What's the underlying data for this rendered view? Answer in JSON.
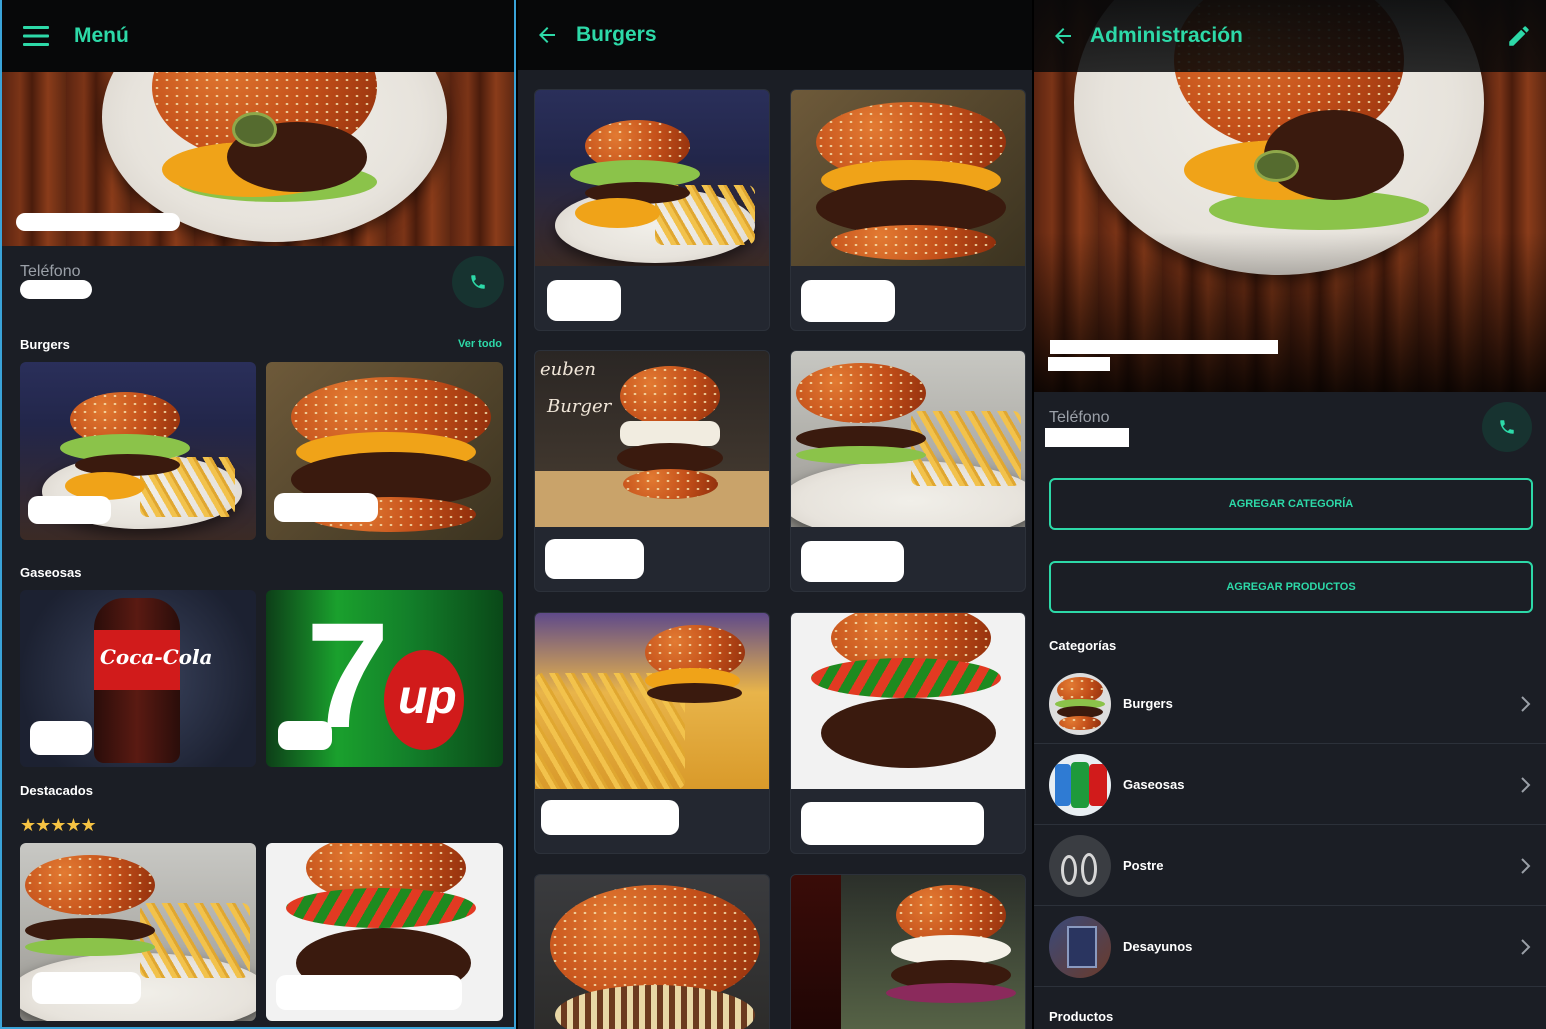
{
  "menu_screen": {
    "title": "Menú",
    "phone_label": "Teléfono",
    "sections": [
      {
        "title": "Burgers",
        "see_all": "Ver todo"
      },
      {
        "title": "Gaseosas"
      },
      {
        "title": "Destacados",
        "rating": "★★★★★"
      }
    ]
  },
  "burgers_screen": {
    "title": "Burgers"
  },
  "admin_screen": {
    "title": "Administración",
    "phone_label": "Teléfono",
    "add_category": "AGREGAR CATEGORÍA",
    "add_products": "AGREGAR PRODUCTOS",
    "categories_title": "Categorías",
    "categories": [
      {
        "name": "Burgers"
      },
      {
        "name": "Gaseosas"
      },
      {
        "name": "Postre"
      },
      {
        "name": "Desayunos"
      }
    ],
    "products_title": "Productos"
  },
  "colors": {
    "accent": "#2dd9a8",
    "background": "#1b1e25",
    "appbar": "#070809"
  },
  "icons": [
    "menu-icon",
    "back-arrow-icon",
    "phone-icon",
    "edit-pencil-icon",
    "chevron-right-icon"
  ]
}
